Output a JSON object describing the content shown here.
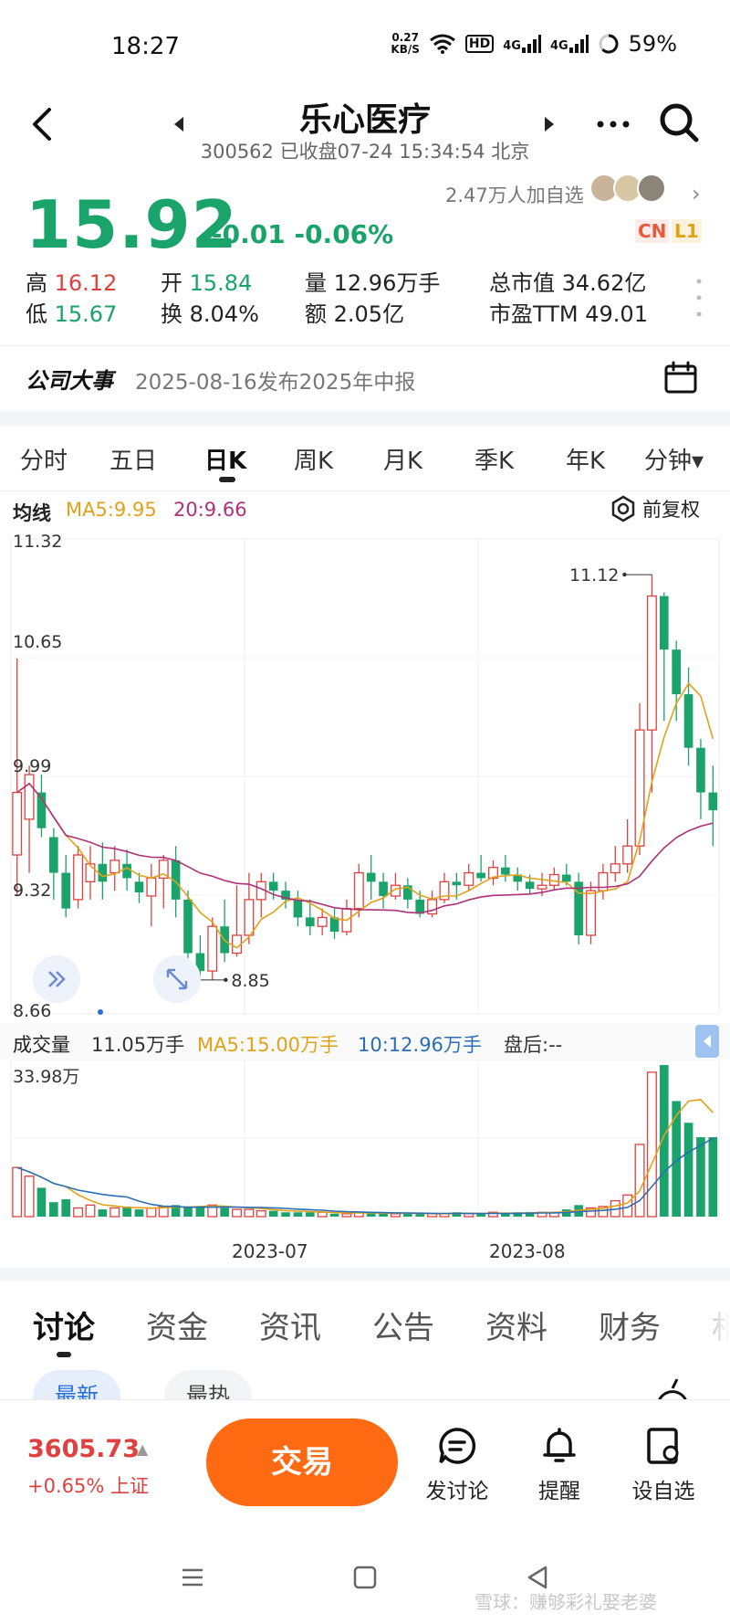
{
  "status_bar": {
    "time": "18:27",
    "net_speed": "0.27",
    "net_unit": "KB/S",
    "hd": "HD",
    "signal1": "4G",
    "signal2": "4G",
    "battery": "59%"
  },
  "header": {
    "name": "乐心医疗",
    "subtitle": "300562 已收盘07-24 15:34:54 北京"
  },
  "quote": {
    "price": "15.92",
    "change": "-0.01 -0.06%",
    "followers": "2.47万人加自选",
    "badge_cn": "CN",
    "badge_l1": "L1",
    "stats": {
      "high_label": "高",
      "high": "16.12",
      "open_label": "开",
      "open": "15.84",
      "vol_label": "量",
      "vol": "12.96万手",
      "mcap_label": "总市值",
      "mcap": "34.62亿",
      "low_label": "低",
      "low": "15.67",
      "turn_label": "换",
      "turn": "8.04%",
      "amt_label": "额",
      "amt": "2.05亿",
      "pe_label": "市盈TTM",
      "pe": "49.01"
    }
  },
  "event": {
    "title": "公司大事",
    "text": "2025-08-16发布2025年中报"
  },
  "period_tabs": [
    "分时",
    "五日",
    "日K",
    "周K",
    "月K",
    "季K",
    "年K",
    "分钟▾"
  ],
  "ma": {
    "label": "均线",
    "ma5": "MA5:9.95",
    "ma20": "20:9.66",
    "adjust": "前复权"
  },
  "volume": {
    "title": "成交量",
    "now": "11.05万手",
    "ma5": "MA5:15.00万手",
    "ma10": "10:12.96万手",
    "after": "盘后:--",
    "max": "33.98万"
  },
  "chart_data": {
    "type": "candlestick",
    "y_ticks": [
      "11.32",
      "10.65",
      "9.99",
      "9.32",
      "8.66"
    ],
    "ylim": [
      8.66,
      11.32
    ],
    "x_ticks": [
      "2023-07",
      "2023-08"
    ],
    "annotations": {
      "high": "11.12",
      "low": "8.85"
    },
    "colors": {
      "up": "#e0413f",
      "down": "#1aa36a",
      "ma5": "#e1a21a",
      "ma20": "#b0307a",
      "vol_ma10": "#2a6fb5"
    },
    "candles": [
      [
        9.55,
        9.9,
        9.32,
        10.65,
        3.4
      ],
      [
        9.75,
        10.0,
        9.45,
        10.05,
        2.8
      ],
      [
        9.9,
        9.7,
        9.65,
        10.0,
        2.0
      ],
      [
        9.65,
        9.45,
        9.3,
        9.7,
        1.0
      ],
      [
        9.45,
        9.25,
        9.2,
        9.55,
        1.2
      ],
      [
        9.3,
        9.55,
        9.25,
        9.6,
        0.6
      ],
      [
        9.4,
        9.5,
        9.3,
        9.6,
        0.8
      ],
      [
        9.5,
        9.4,
        9.3,
        9.62,
        0.5
      ],
      [
        9.45,
        9.52,
        9.35,
        9.6,
        0.6
      ],
      [
        9.5,
        9.42,
        9.35,
        9.58,
        0.7
      ],
      [
        9.4,
        9.34,
        9.28,
        9.45,
        0.5
      ],
      [
        9.32,
        9.42,
        9.15,
        9.5,
        0.6
      ],
      [
        9.42,
        9.52,
        9.25,
        9.55,
        0.7
      ],
      [
        9.52,
        9.3,
        9.2,
        9.6,
        0.8
      ],
      [
        9.3,
        9.0,
        8.95,
        9.35,
        0.7
      ],
      [
        9.0,
        8.9,
        8.85,
        9.1,
        0.7
      ],
      [
        8.9,
        9.15,
        8.85,
        9.2,
        0.8
      ],
      [
        9.15,
        9.0,
        8.95,
        9.3,
        0.6
      ],
      [
        9.0,
        9.1,
        8.98,
        9.38,
        0.5
      ],
      [
        9.1,
        9.3,
        9.05,
        9.45,
        0.5
      ],
      [
        9.3,
        9.4,
        9.2,
        9.45,
        0.4
      ],
      [
        9.4,
        9.35,
        9.3,
        9.45,
        0.4
      ],
      [
        9.35,
        9.3,
        9.25,
        9.4,
        0.3
      ],
      [
        9.3,
        9.2,
        9.15,
        9.35,
        0.3
      ],
      [
        9.2,
        9.15,
        9.1,
        9.3,
        0.3
      ],
      [
        9.15,
        9.2,
        9.1,
        9.25,
        0.3
      ],
      [
        9.2,
        9.12,
        9.08,
        9.25,
        0.2
      ],
      [
        9.12,
        9.25,
        9.1,
        9.3,
        0.2
      ],
      [
        9.25,
        9.45,
        9.2,
        9.5,
        0.3
      ],
      [
        9.45,
        9.4,
        9.3,
        9.55,
        0.3
      ],
      [
        9.4,
        9.32,
        9.25,
        9.45,
        0.2
      ],
      [
        9.32,
        9.38,
        9.3,
        9.45,
        0.2
      ],
      [
        9.38,
        9.3,
        9.25,
        9.42,
        0.2
      ],
      [
        9.3,
        9.22,
        9.2,
        9.35,
        0.2
      ],
      [
        9.22,
        9.3,
        9.2,
        9.35,
        0.2
      ],
      [
        9.3,
        9.4,
        9.28,
        9.45,
        0.2
      ],
      [
        9.4,
        9.38,
        9.3,
        9.45,
        0.3
      ],
      [
        9.38,
        9.45,
        9.35,
        9.5,
        0.2
      ],
      [
        9.45,
        9.42,
        9.4,
        9.55,
        0.2
      ],
      [
        9.42,
        9.48,
        9.38,
        9.52,
        0.3
      ],
      [
        9.48,
        9.44,
        9.4,
        9.55,
        0.2
      ],
      [
        9.44,
        9.4,
        9.35,
        9.48,
        0.3
      ],
      [
        9.4,
        9.36,
        9.33,
        9.44,
        0.3
      ],
      [
        9.36,
        9.38,
        9.32,
        9.45,
        0.3
      ],
      [
        9.38,
        9.44,
        9.35,
        9.48,
        0.3
      ],
      [
        9.44,
        9.4,
        9.38,
        9.5,
        0.5
      ],
      [
        9.4,
        9.1,
        9.05,
        9.45,
        0.8
      ],
      [
        9.1,
        9.35,
        9.05,
        9.4,
        0.6
      ],
      [
        9.35,
        9.45,
        9.3,
        9.5,
        0.7
      ],
      [
        9.45,
        9.5,
        9.4,
        9.6,
        1.1
      ],
      [
        9.5,
        9.6,
        9.45,
        9.75,
        1.5
      ],
      [
        9.6,
        10.25,
        9.55,
        10.4,
        5.0
      ],
      [
        10.25,
        11.0,
        9.9,
        11.12,
        10.0
      ],
      [
        11.0,
        10.7,
        10.3,
        11.02,
        10.5
      ],
      [
        10.7,
        10.45,
        10.3,
        10.75,
        8.0
      ],
      [
        10.45,
        10.15,
        10.05,
        10.6,
        6.5
      ],
      [
        10.15,
        9.9,
        9.75,
        10.2,
        5.5
      ],
      [
        9.9,
        9.8,
        9.6,
        10.05,
        5.5
      ]
    ]
  },
  "content_tabs": [
    "讨论",
    "资金",
    "资讯",
    "公告",
    "资料",
    "财务",
    "相"
  ],
  "pills": [
    "最新",
    "最热"
  ],
  "bottom": {
    "index_value": "3605.73",
    "index_change": "+0.65% 上证",
    "trade": "交易",
    "post": "发讨论",
    "alert": "提醒",
    "watch": "设自选"
  },
  "watermark": "雪球：赚够彩礼娶老婆"
}
